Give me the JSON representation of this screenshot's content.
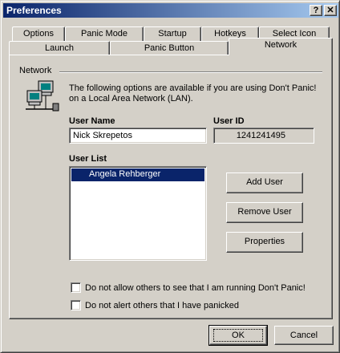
{
  "window": {
    "title": "Preferences",
    "help_glyph": "?",
    "close_glyph": "✕"
  },
  "tabs_back": [
    "Options",
    "Panic Mode",
    "Startup",
    "Hotkeys",
    "Select Icon"
  ],
  "tabs_front": [
    "Launch",
    "Panic Button",
    "Network"
  ],
  "active_tab": "Network",
  "network": {
    "group_label": "Network",
    "description_line1": "The following options are available if you are using Don't Panic!",
    "description_line2": "on a Local Area Network (LAN).",
    "user_name_label": "User Name",
    "user_name_value": "Nick Skrepetos",
    "user_id_label": "User ID",
    "user_id_value": "1241241495",
    "user_list_label": "User List",
    "user_list": [
      "Angela Rehberger"
    ],
    "add_user": "Add User",
    "remove_user": "Remove User",
    "properties": "Properties",
    "check_hide_running": "Do not allow others to see that I am running Don't Panic!",
    "check_no_alert": "Do not alert others that I have panicked"
  },
  "footer": {
    "ok": "OK",
    "cancel": "Cancel"
  },
  "colors": {
    "titlebar_start": "#0a246a",
    "titlebar_end": "#a6caf0",
    "selection": "#0a246a",
    "face": "#d4d0c8"
  }
}
